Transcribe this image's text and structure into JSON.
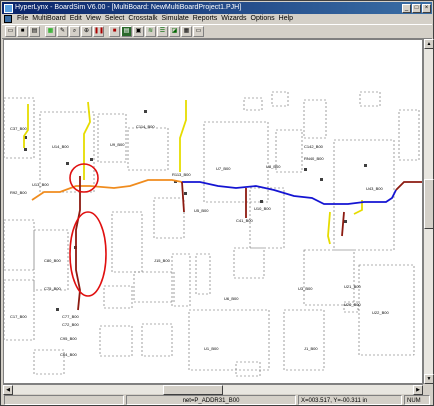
{
  "window": {
    "title": "HyperLynx - BoardSim V6.00 - [MultiBoard: NewMultiBoardProject1.PJH]"
  },
  "menu": [
    "File",
    "MultiBoard",
    "Edit",
    "View",
    "Select",
    "Crosstalk",
    "Simulate",
    "Reports",
    "Wizards",
    "Options",
    "Help"
  ],
  "toolbar_icons": [
    "open-icon",
    "save-icon",
    "print-icon",
    "board-icon",
    "net-icon",
    "zoom-icon",
    "zoom-fit-icon",
    "pause-icon",
    "stop-icon",
    "scope-icon",
    "simulate-icon",
    "crosstalk-icon",
    "stackup-icon",
    "graph-icon",
    "grid-icon",
    "export-icon"
  ],
  "canvas": {
    "labels": [
      {
        "id": "c37",
        "text": "C37_B00"
      },
      {
        "id": "u14",
        "text": "U14_B00"
      },
      {
        "id": "u9",
        "text": "U9_B00"
      },
      {
        "id": "c114",
        "text": "C114_B00"
      },
      {
        "id": "u13",
        "text": "U13_B00"
      },
      {
        "id": "r92",
        "text": "R92_B00"
      },
      {
        "id": "r113",
        "text": "R113_B00"
      },
      {
        "id": "u7",
        "text": "U7_B00"
      },
      {
        "id": "u8",
        "text": "U8_B00"
      },
      {
        "id": "u43",
        "text": "U43_B00"
      },
      {
        "id": "u10",
        "text": "U10_B00"
      },
      {
        "id": "c41",
        "text": "C41_B00"
      },
      {
        "id": "u5",
        "text": "U5_B00"
      },
      {
        "id": "c80",
        "text": "C80_B00"
      },
      {
        "id": "c75",
        "text": "C75_B00"
      },
      {
        "id": "c77",
        "text": "C77_B00"
      },
      {
        "id": "c72",
        "text": "C72_B00"
      },
      {
        "id": "c95",
        "text": "C95_B00"
      },
      {
        "id": "c64",
        "text": "C64_B00"
      },
      {
        "id": "j15",
        "text": "J15_B00"
      },
      {
        "id": "u21",
        "text": "U21_B00"
      },
      {
        "id": "u20",
        "text": "U20_B00"
      },
      {
        "id": "u22",
        "text": "U22_B00"
      },
      {
        "id": "c17",
        "text": "C17_B00"
      },
      {
        "id": "u6",
        "text": "U6_B00"
      },
      {
        "id": "u3",
        "text": "U3_B00"
      },
      {
        "id": "rn40",
        "text": "RN40_B00"
      },
      {
        "id": "c142",
        "text": "C142_B00"
      },
      {
        "id": "u1",
        "text": "U1_B00"
      },
      {
        "id": "j1",
        "text": "J1_B00"
      }
    ]
  },
  "status": {
    "net": "net=P_ADDR31_B00",
    "coords": "X=003.517, Y=-00.311 in",
    "num": "NUM"
  },
  "colors": {
    "orange_trace": "#f08c1e",
    "blue_trace": "#1414d2",
    "yellow_trace": "#e6dc00",
    "darkred_trace": "#8c1a10",
    "highlight": "#e01010"
  }
}
